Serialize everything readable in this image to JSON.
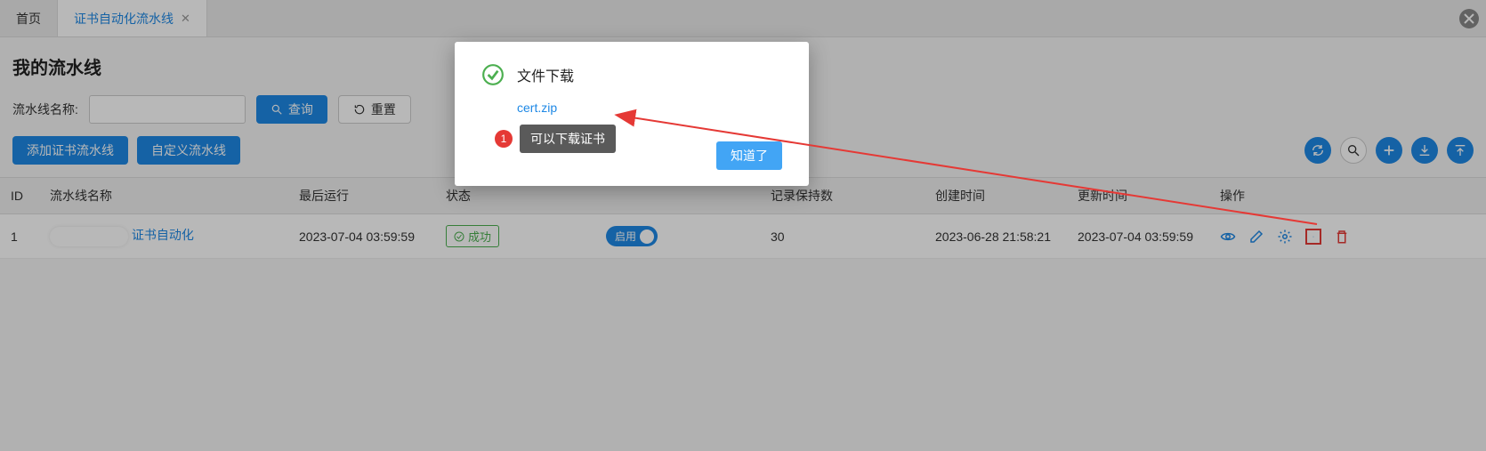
{
  "tabs": {
    "home": "首页",
    "active": "证书自动化流水线"
  },
  "page_title": "我的流水线",
  "filter": {
    "label": "流水线名称:",
    "value": "",
    "search": "查询",
    "reset": "重置"
  },
  "actions": {
    "add_cert": "添加证书流水线",
    "custom": "自定义流水线"
  },
  "columns": {
    "id": "ID",
    "name": "流水线名称",
    "last_run": "最后运行",
    "status": "状态",
    "state": "",
    "keep": "记录保持数",
    "create": "创建时间",
    "update": "更新时间",
    "ops": "操作"
  },
  "rows": [
    {
      "id": "1",
      "name_suffix": "证书自动化",
      "last_run": "2023-07-04 03:59:59",
      "status": "成功",
      "state_label": "启用",
      "keep": "30",
      "create": "2023-06-28 21:58:21",
      "update": "2023-07-04 03:59:59"
    }
  ],
  "modal": {
    "title": "文件下载",
    "link": "cert.zip",
    "ok": "知道了"
  },
  "callout": {
    "num": "1",
    "text": "可以下载证书"
  }
}
